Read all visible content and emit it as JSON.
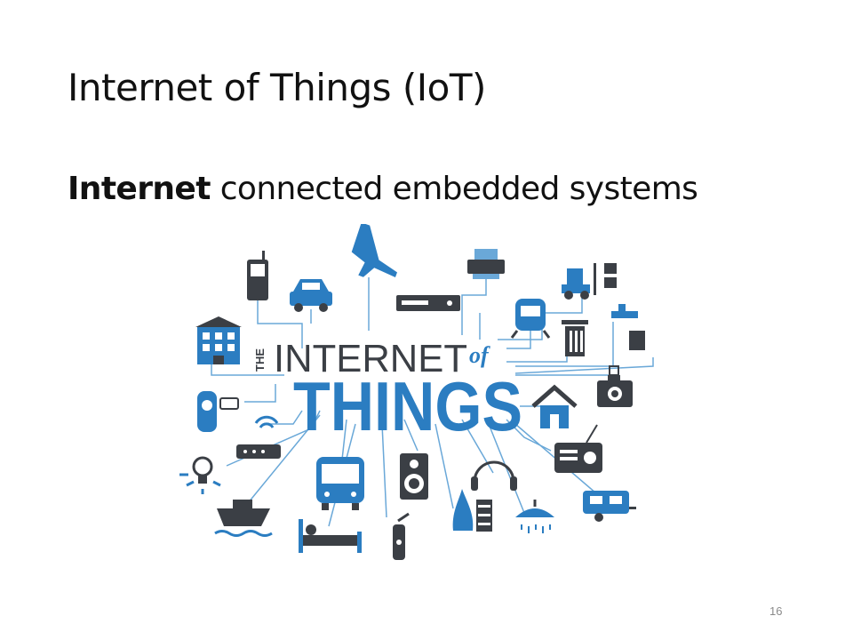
{
  "slide": {
    "title": "Internet of Things (IoT)",
    "subtitle_bold": "Internet",
    "subtitle_rest": " connected embedded systems",
    "page_number": "16"
  },
  "graphic": {
    "the": "THE",
    "internet": "INTERNET",
    "of": "of",
    "things": "THINGS",
    "colors": {
      "dark": "#3b3f45",
      "blue": "#2b7dc1",
      "line": "#6aa8d8"
    },
    "icons": [
      "mobile-phone-icon",
      "car-icon",
      "airplane-icon",
      "printer-icon",
      "forklift-icon",
      "building-icon",
      "dvd-player-icon",
      "train-icon",
      "trash-can-icon",
      "faucet-icon",
      "camera-icon",
      "home-icon",
      "security-camera-icon",
      "wifi-router-icon",
      "radio-icon",
      "light-bulb-icon",
      "bus-icon",
      "speaker-icon",
      "headphones-icon",
      "ship-icon",
      "bed-icon",
      "fire-extinguisher-icon",
      "fireplace-icon",
      "shower-icon",
      "caravan-icon"
    ]
  }
}
